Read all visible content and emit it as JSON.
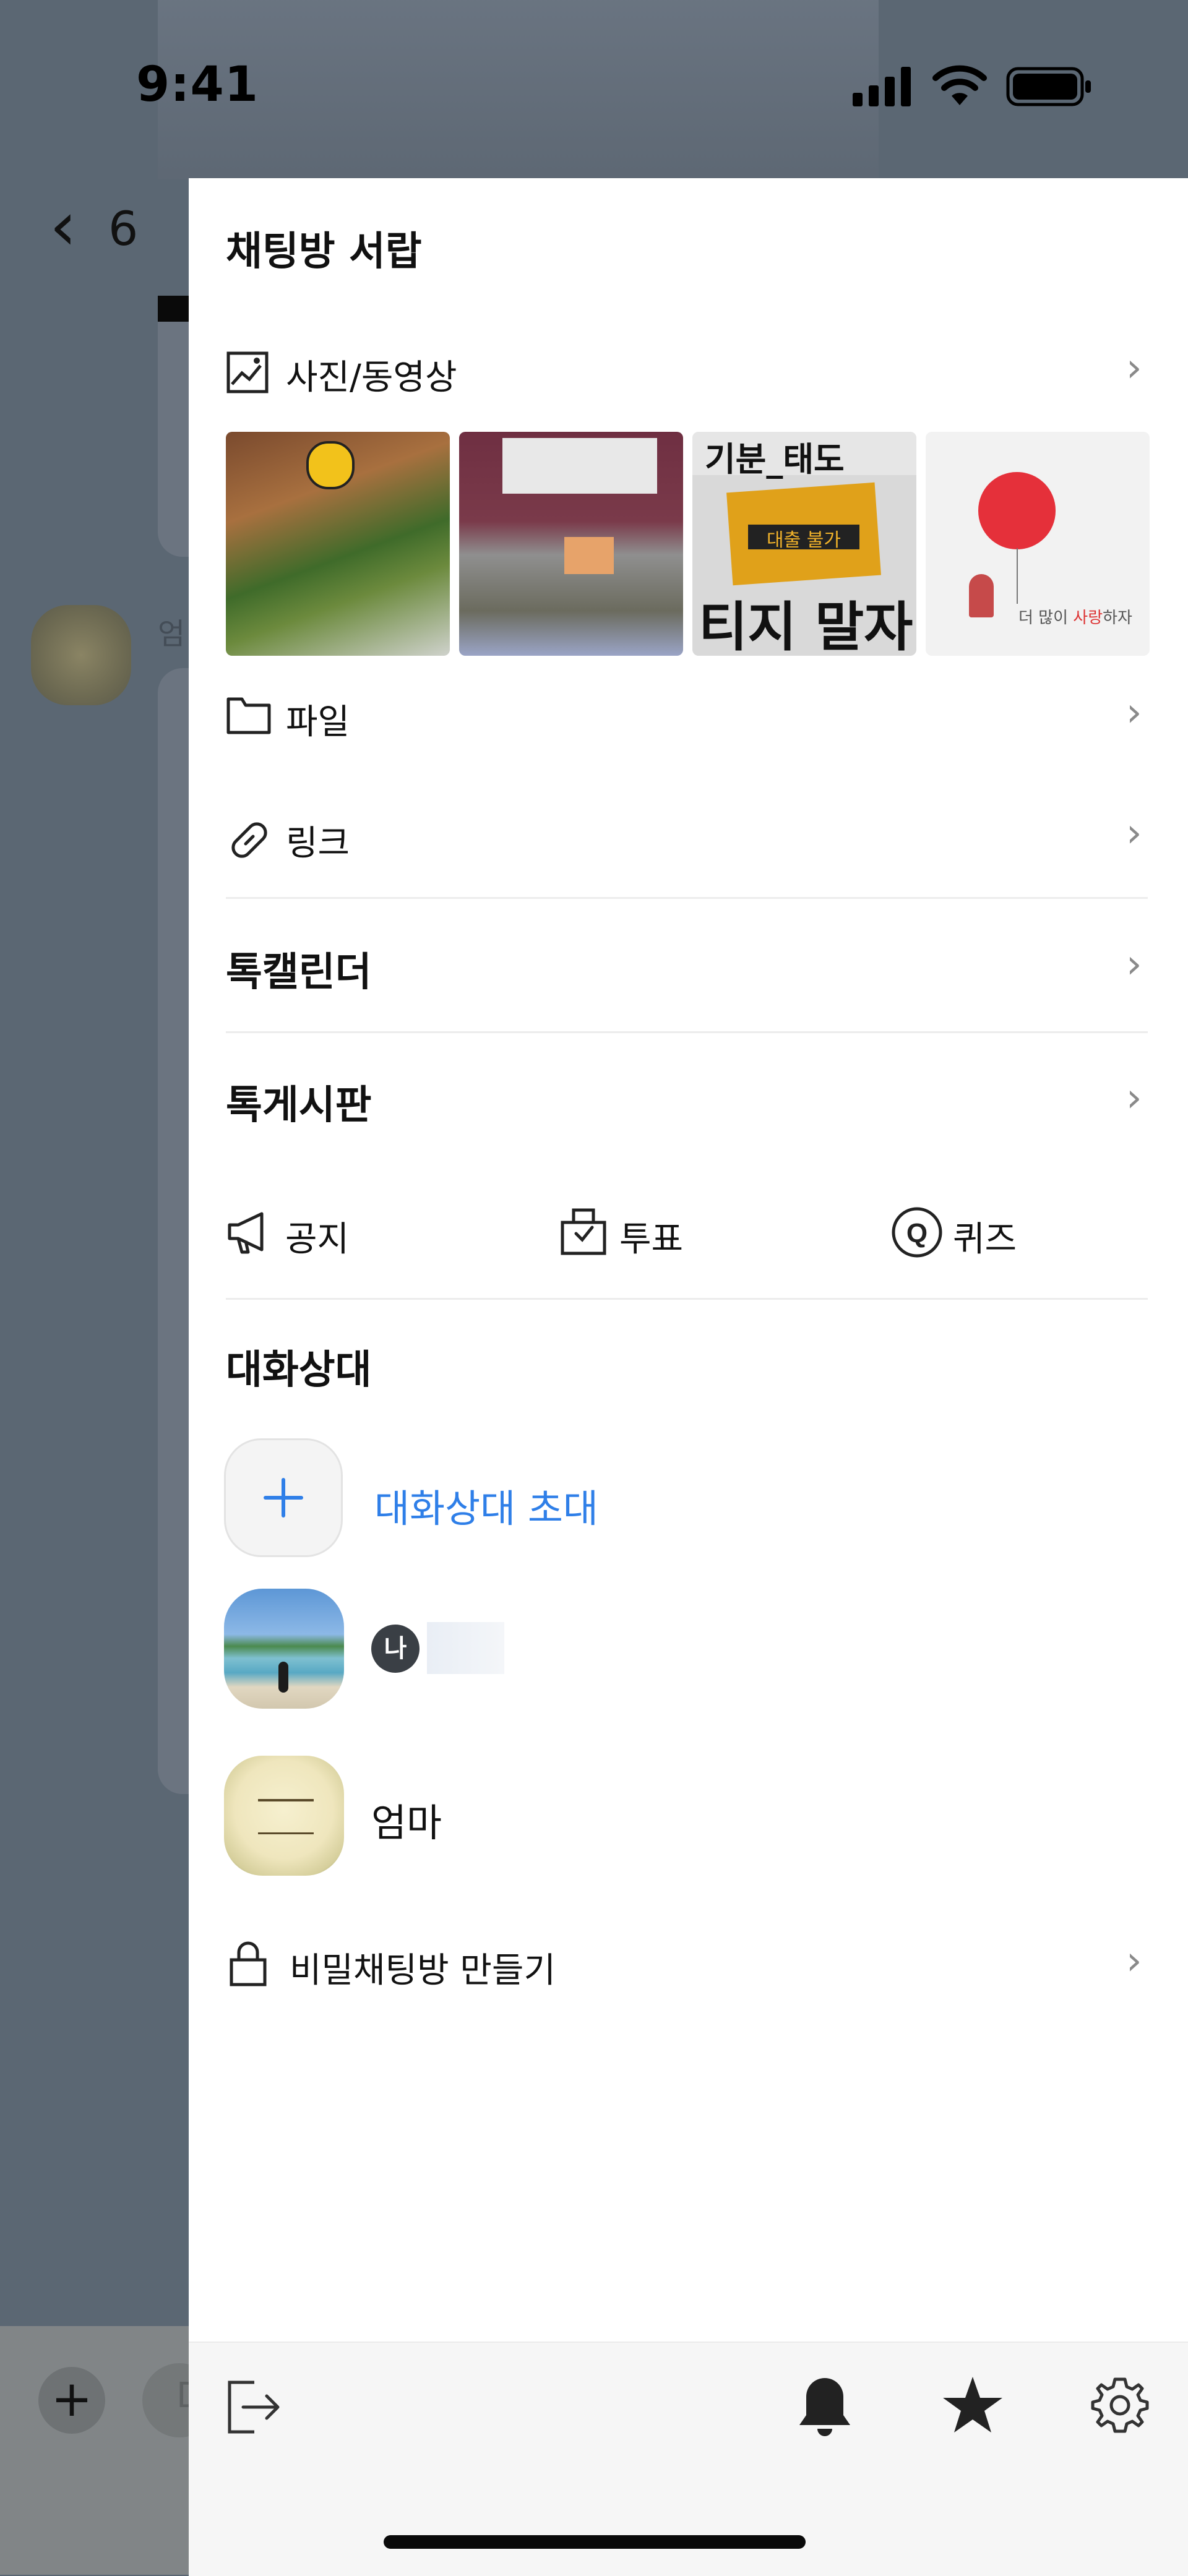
{
  "status_bar": {
    "time": "9:41"
  },
  "background_chat": {
    "back_count": "6",
    "member_name_partial": "엄",
    "input_partial": "D"
  },
  "drawer": {
    "title": "채팅방 서랍",
    "media": {
      "label": "사진/동영상"
    },
    "file": {
      "label": "파일"
    },
    "link": {
      "label": "링크"
    },
    "talk_calendar": {
      "label": "톡캘린더"
    },
    "talk_board": {
      "label": "톡게시판"
    },
    "board_tools": [
      {
        "label": "공지",
        "icon": "megaphone-icon"
      },
      {
        "label": "투표",
        "icon": "vote-box-icon"
      },
      {
        "label": "퀴즈",
        "icon": "quiz-icon"
      }
    ],
    "members": {
      "title": "대화상대",
      "invite_label": "대화상대 초대",
      "me_badge": "나",
      "people": [
        {
          "name": ""
        },
        {
          "name": "엄마"
        }
      ]
    },
    "secret_chat": {
      "label": "비밀채팅방 만들기"
    },
    "thumbnails": [
      {
        "caption": ""
      },
      {
        "caption": ""
      },
      {
        "caption": "기분_태도 / 대출 불가 / 티지 말자"
      },
      {
        "caption": "더 많이 사랑하자"
      }
    ]
  },
  "colors": {
    "accent": "#2f7fe8",
    "text": "#111111",
    "chevron": "#8a8a8a",
    "footer_bg": "#f6f6f6"
  }
}
